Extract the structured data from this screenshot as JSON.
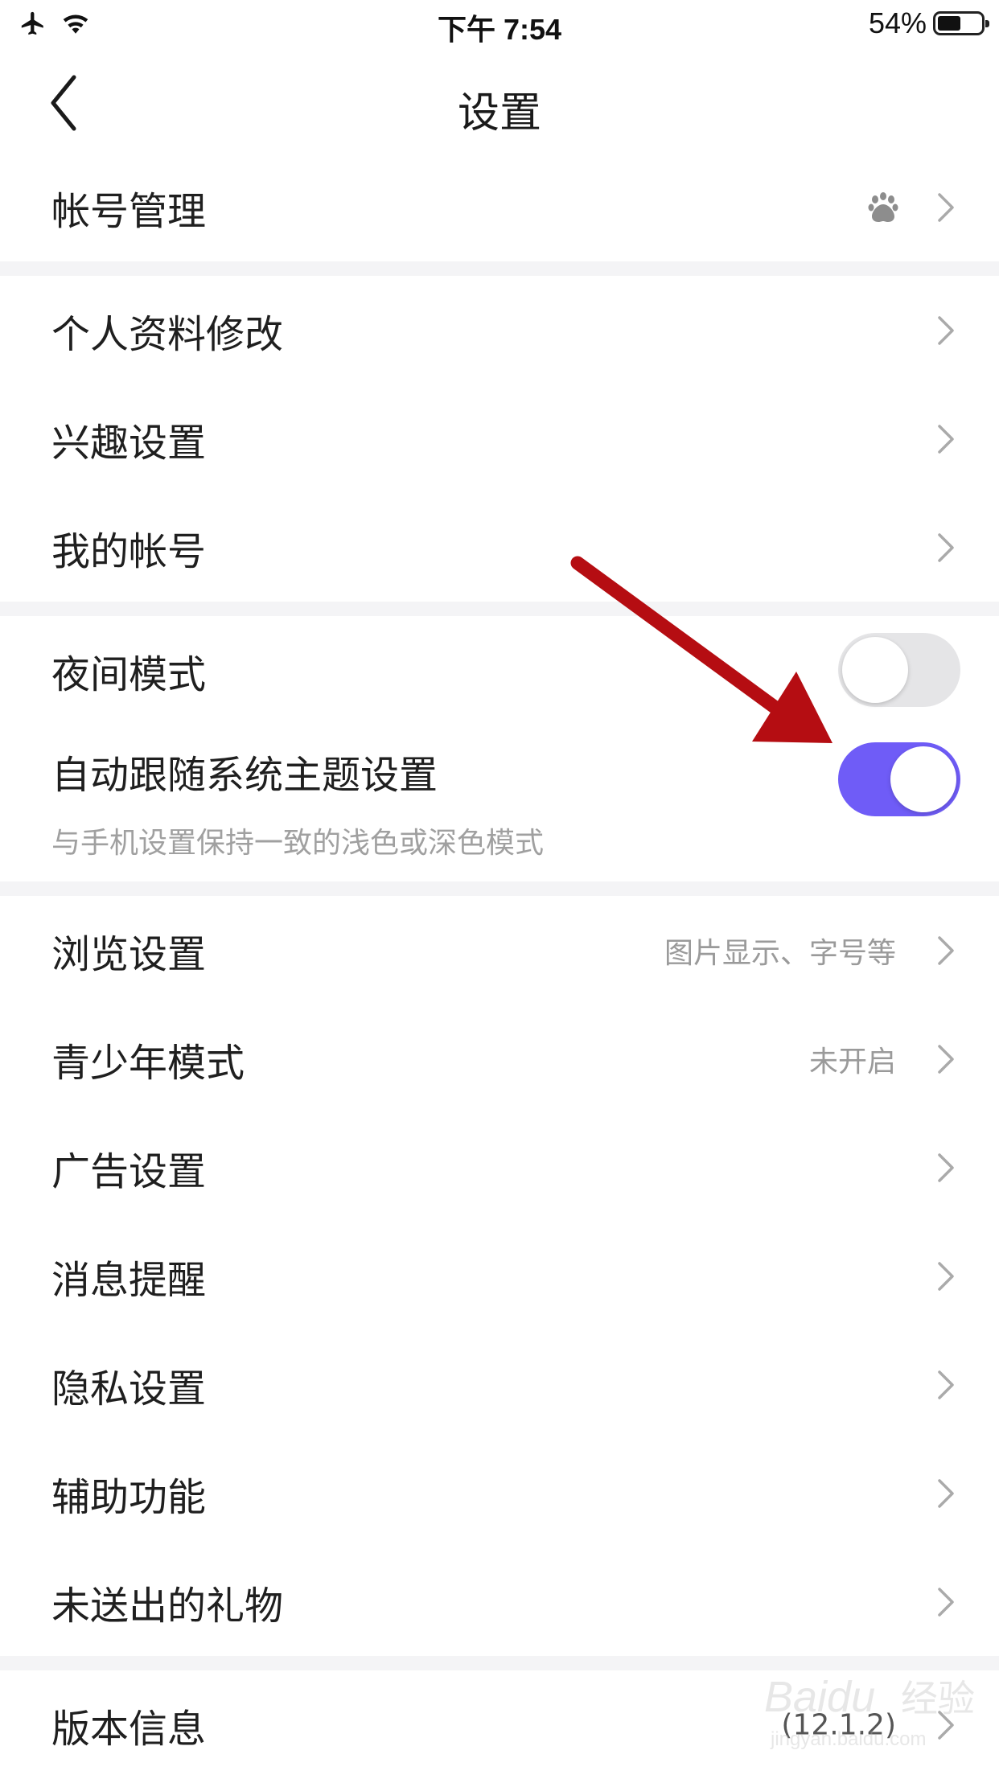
{
  "status_bar": {
    "time": "下午 7:54",
    "battery_percent": "54%",
    "battery_level": 0.54
  },
  "nav": {
    "title": "设置",
    "back_icon": "chevron-left-icon"
  },
  "account": {
    "label": "帐号管理",
    "icon": "baidu-paw-icon"
  },
  "profile_group": [
    {
      "label": "个人资料修改"
    },
    {
      "label": "兴趣设置"
    },
    {
      "label": "我的帐号"
    }
  ],
  "display_group": {
    "night_mode": {
      "label": "夜间模式",
      "enabled": false
    },
    "follow_system": {
      "label": "自动跟随系统主题设置",
      "description": "与手机设置保持一致的浅色或深色模式",
      "enabled": true
    }
  },
  "settings_group": [
    {
      "label": "浏览设置",
      "value": "图片显示、字号等"
    },
    {
      "label": "青少年模式",
      "value": "未开启"
    },
    {
      "label": "广告设置",
      "value": ""
    },
    {
      "label": "消息提醒",
      "value": ""
    },
    {
      "label": "隐私设置",
      "value": ""
    },
    {
      "label": "辅助功能",
      "value": ""
    },
    {
      "label": "未送出的礼物",
      "value": ""
    }
  ],
  "version": {
    "label": "版本信息",
    "value": "(12.1.2)"
  },
  "colors": {
    "accent": "#6f5cf7",
    "arrow": "#b50d12",
    "section_gap": "#f4f4f6"
  }
}
